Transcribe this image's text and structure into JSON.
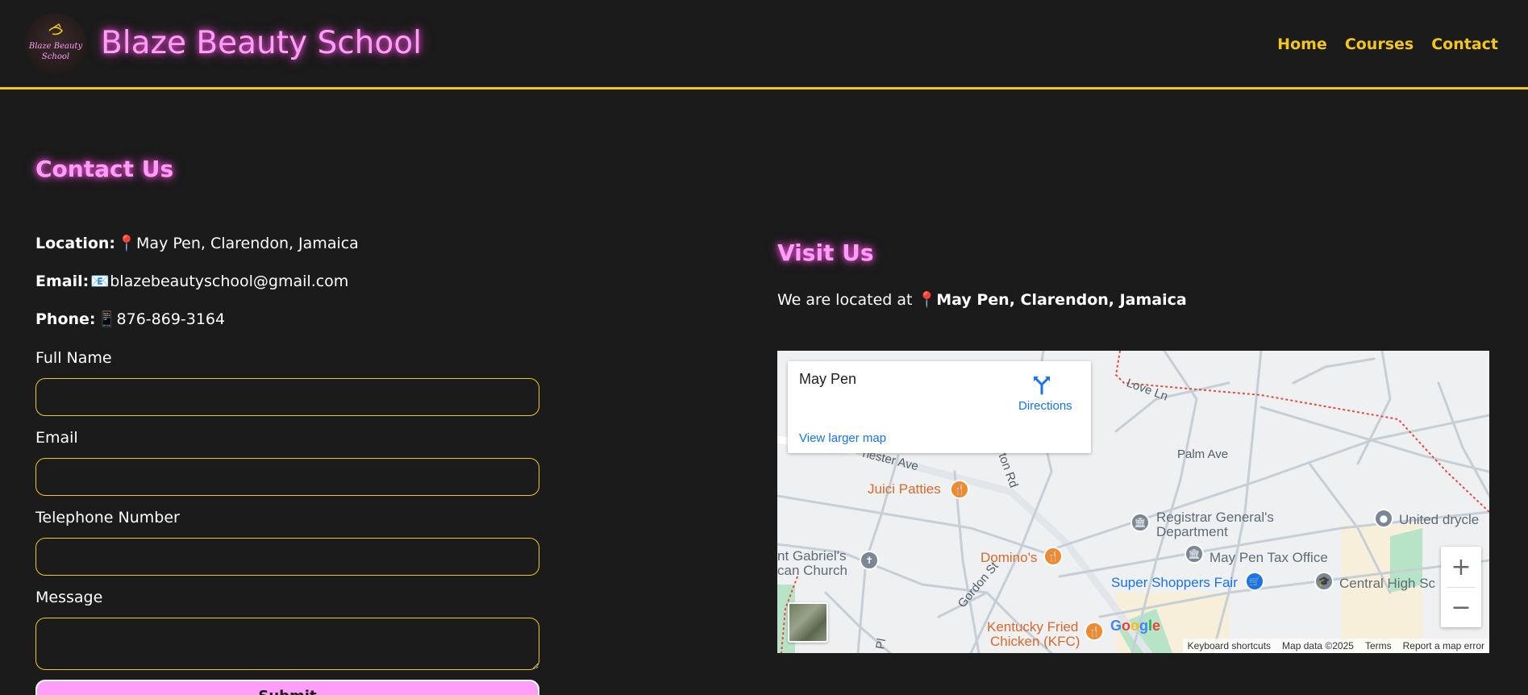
{
  "header": {
    "brand": "Blaze Beauty School",
    "logo_text": "Blaze Beauty School",
    "nav": [
      "Home",
      "Courses",
      "Contact"
    ],
    "accent_color": "#f5c518",
    "brand_color": "#ff9ef8"
  },
  "contact": {
    "title": "Contact Us",
    "location_label": "Location:",
    "location_icon": "📍",
    "location_value": "May Pen, Clarendon, Jamaica",
    "email_label": "Email:",
    "email_icon": "📧",
    "email_value": "blazebeautyschool@gmail.com",
    "phone_label": "Phone:",
    "phone_icon": "📱",
    "phone_value": "876-869-3164",
    "form": {
      "full_name_label": "Full Name",
      "email_label": "Email",
      "telephone_label": "Telephone Number",
      "message_label": "Message",
      "submit_label": "Submit"
    }
  },
  "visit": {
    "title": "Visit Us",
    "text_prefix": "We are located at",
    "pin_icon": "📍",
    "text_location": "May Pen, Clarendon, Jamaica"
  },
  "map": {
    "place_name": "May Pen",
    "directions": "Directions",
    "view_larger": "View larger map",
    "labels": {
      "love_ln": "Love Ln",
      "palm_ave": "Palm Ave",
      "chester_ave": "hester Ave",
      "ton_rd": "ton Rd",
      "gordon_st": "Gordon St",
      "pl": "Pl",
      "juici": "Juici Patties",
      "dominos": "Domino's",
      "kfc_1": "Kentucky Fried",
      "kfc_2": "Chicken (KFC)",
      "registrar_1": "Registrar General's",
      "registrar_2": "Department",
      "tax_office": "May Pen Tax Office",
      "super_shoppers": "Super Shoppers Fair",
      "central_high": "Central High Sc",
      "united": "United drycle",
      "gabriel_1": "nt Gabriel's",
      "gabriel_2": "can Church"
    },
    "google": "Google",
    "attribution": [
      "Keyboard shortcuts",
      "Map data ©2025",
      "Terms",
      "Report a map error"
    ]
  }
}
